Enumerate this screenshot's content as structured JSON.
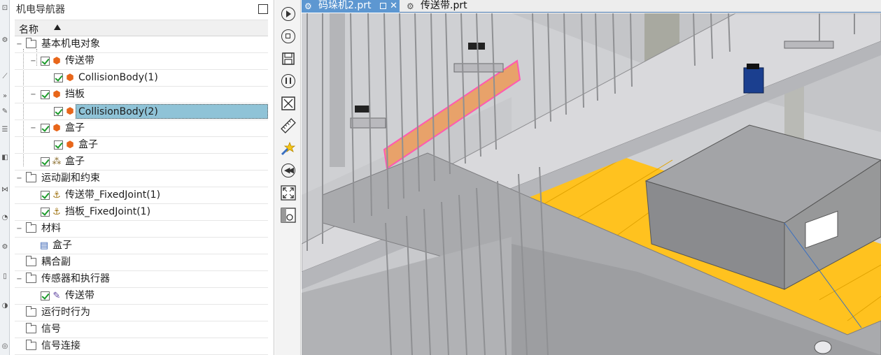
{
  "navigator": {
    "title": "机电导航器",
    "column_name": "名称",
    "items": [
      {
        "label": "基本机电对象"
      },
      {
        "label": "传送带"
      },
      {
        "label": "CollisionBody(1)"
      },
      {
        "label": "挡板"
      },
      {
        "label": "CollisionBody(2)"
      },
      {
        "label": "盒子"
      },
      {
        "label": "盒子"
      },
      {
        "label": "盒子"
      },
      {
        "label": "运动副和约束"
      },
      {
        "label": "传送带_FixedJoint(1)"
      },
      {
        "label": "挡板_FixedJoint(1)"
      },
      {
        "label": "材料"
      },
      {
        "label": "盒子"
      },
      {
        "label": "耦合副"
      },
      {
        "label": "传感器和执行器"
      },
      {
        "label": "传送带"
      },
      {
        "label": "运行时行为"
      },
      {
        "label": "信号"
      },
      {
        "label": "信号连接"
      }
    ]
  },
  "tabs": [
    {
      "label": "码垛机2.prt",
      "icon": "part-file-icon",
      "active": true
    },
    {
      "label": "传送带.prt",
      "icon": "part-file-icon",
      "active": false
    }
  ],
  "toolbar": {
    "icons": [
      "play-icon",
      "stop-icon",
      "save-snapshot-icon",
      "pause-icon",
      "close-view-icon",
      "measure-icon",
      "magic-wand-icon",
      "rewind-icon",
      "fit-view-icon",
      "section-view-icon"
    ]
  },
  "colors": {
    "active_tab": "#5d97d1",
    "selection": "#8fc3d7",
    "conveyor_belt": "#ffc21f",
    "baffle": "#e8a26a"
  }
}
